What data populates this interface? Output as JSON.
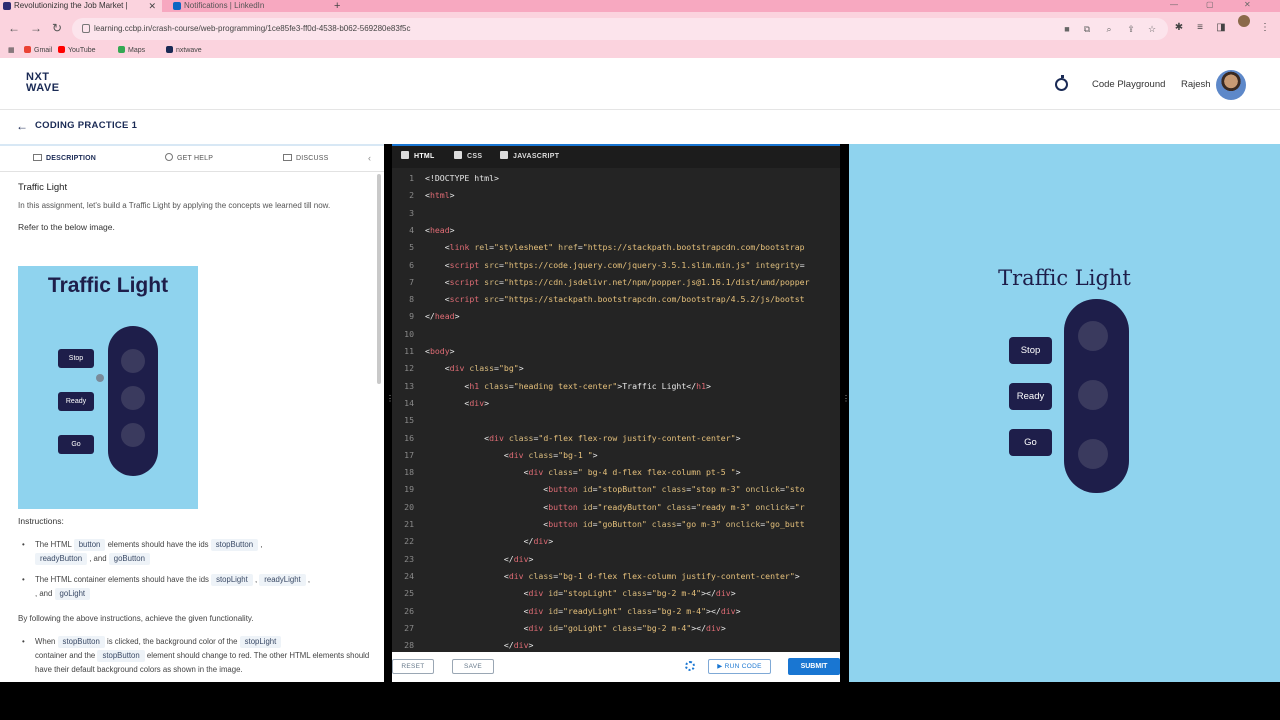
{
  "browser": {
    "tabs": [
      {
        "label": "Revolutionizing the Job Market |",
        "close": "✕"
      },
      {
        "label": "Notifications | LinkedIn"
      }
    ],
    "new_tab": "+",
    "url": "learning.ccbp.in/crash-course/web-programming/1ce85fe3-ff0d-4538-b062-569280e83f5c",
    "bookmarks": [
      {
        "label": "Gmail",
        "color": "#ea4335"
      },
      {
        "label": "YouTube",
        "color": "#ff0000"
      },
      {
        "label": "Maps",
        "color": "#34a853"
      },
      {
        "label": "nxtwave",
        "color": "#1a2a55"
      }
    ]
  },
  "header": {
    "logo_line1": "NXT",
    "logo_line2": "WAVE",
    "playground": "Code Playground",
    "user": "Rajesh"
  },
  "subheader": {
    "back": "←",
    "title": "CODING PRACTICE 1"
  },
  "left": {
    "tabs": [
      "DESCRIPTION",
      "GET HELP",
      "DISCUSS"
    ],
    "collapse": "‹",
    "heading": "Traffic Light",
    "intro": "In this assignment, let's build a Traffic Light by applying the concepts we learned till now.",
    "refer": "Refer to the below image.",
    "preview": {
      "title": "Traffic Light",
      "buttons": [
        "Stop",
        "Ready",
        "Go"
      ]
    },
    "instructions_label": "Instructions:",
    "bullet1": {
      "pre": "The HTML",
      "tag1": "button",
      "mid": "elements should have the ids",
      "tag2": "stopButton",
      "comma": ",",
      "tag3": "readyButton",
      "and": ", and",
      "tag4": "goButton"
    },
    "bullet2": {
      "pre": "The HTML container elements should have the ids",
      "tag1": "stopLight",
      "comma": ",",
      "tag2": "readyLight",
      "and": ", and",
      "tag3": "goLight"
    },
    "following": "By following the above instructions, achieve the given functionality.",
    "bullet3": {
      "pre": "When",
      "tag1": "stopButton",
      "mid": "is clicked, the background color of the",
      "tag2": "stopLight",
      "mid2": "container and the",
      "tag3": "stopButton",
      "end": "element should change to red. The other HTML elements should have their default background colors as shown in the image."
    }
  },
  "editor": {
    "tabs": [
      "HTML",
      "CSS",
      "JAVASCRIPT"
    ],
    "lines": [
      {
        "n": "1",
        "parts": [
          [
            "",
            "<!DOCTYPE html>"
          ]
        ]
      },
      {
        "n": "2",
        "parts": [
          [
            "",
            "<"
          ],
          [
            "t",
            "html"
          ],
          [
            "",
            ">"
          ]
        ]
      },
      {
        "n": "3",
        "parts": []
      },
      {
        "n": "4",
        "parts": [
          [
            "",
            "<"
          ],
          [
            "t",
            "head"
          ],
          [
            "",
            ">"
          ]
        ]
      },
      {
        "n": "5",
        "parts": [
          [
            "",
            "    <"
          ],
          [
            "t",
            "link"
          ],
          [
            "",
            " "
          ],
          [
            "a",
            "rel"
          ],
          [
            "",
            "="
          ],
          [
            "s",
            "\"stylesheet\""
          ],
          [
            "",
            " "
          ],
          [
            "a",
            "href"
          ],
          [
            "",
            "="
          ],
          [
            "s",
            "\"https://stackpath.bootstrapcdn.com/bootstrap"
          ]
        ]
      },
      {
        "n": "6",
        "parts": [
          [
            "",
            "    <"
          ],
          [
            "t",
            "script"
          ],
          [
            "",
            " "
          ],
          [
            "a",
            "src"
          ],
          [
            "",
            "="
          ],
          [
            "s",
            "\"https://code.jquery.com/jquery-3.5.1.slim.min.js\""
          ],
          [
            "",
            " "
          ],
          [
            "a",
            "integrity"
          ],
          [
            "",
            "="
          ]
        ]
      },
      {
        "n": "7",
        "parts": [
          [
            "",
            "    <"
          ],
          [
            "t",
            "script"
          ],
          [
            "",
            " "
          ],
          [
            "a",
            "src"
          ],
          [
            "",
            "="
          ],
          [
            "s",
            "\"https://cdn.jsdelivr.net/npm/popper.js@1.16.1/dist/umd/popper"
          ]
        ]
      },
      {
        "n": "8",
        "parts": [
          [
            "",
            "    <"
          ],
          [
            "t",
            "script"
          ],
          [
            "",
            " "
          ],
          [
            "a",
            "src"
          ],
          [
            "",
            "="
          ],
          [
            "s",
            "\"https://stackpath.bootstrapcdn.com/bootstrap/4.5.2/js/bootst"
          ]
        ]
      },
      {
        "n": "9",
        "parts": [
          [
            "",
            "</"
          ],
          [
            "t",
            "head"
          ],
          [
            "",
            ">"
          ]
        ]
      },
      {
        "n": "10",
        "parts": []
      },
      {
        "n": "11",
        "parts": [
          [
            "",
            "<"
          ],
          [
            "t",
            "body"
          ],
          [
            "",
            ">"
          ]
        ]
      },
      {
        "n": "12",
        "parts": [
          [
            "",
            "    <"
          ],
          [
            "t",
            "div"
          ],
          [
            "",
            " "
          ],
          [
            "a",
            "class"
          ],
          [
            "",
            "="
          ],
          [
            "s",
            "\"bg\""
          ],
          [
            "",
            ">"
          ]
        ]
      },
      {
        "n": "13",
        "parts": [
          [
            "",
            "        <"
          ],
          [
            "t",
            "h1"
          ],
          [
            "",
            " "
          ],
          [
            "a",
            "class"
          ],
          [
            "",
            "="
          ],
          [
            "s",
            "\"heading text-center\""
          ],
          [
            "",
            ">Traffic Light</"
          ],
          [
            "t",
            "h1"
          ],
          [
            "",
            ">"
          ]
        ]
      },
      {
        "n": "14",
        "parts": [
          [
            "",
            "        <"
          ],
          [
            "t",
            "div"
          ],
          [
            "",
            ">"
          ]
        ]
      },
      {
        "n": "15",
        "parts": []
      },
      {
        "n": "16",
        "parts": [
          [
            "",
            "            <"
          ],
          [
            "t",
            "div"
          ],
          [
            "",
            " "
          ],
          [
            "a",
            "class"
          ],
          [
            "",
            "="
          ],
          [
            "s",
            "\"d-flex flex-row justify-content-center\""
          ],
          [
            "",
            ">"
          ]
        ]
      },
      {
        "n": "17",
        "parts": [
          [
            "",
            "                <"
          ],
          [
            "t",
            "div"
          ],
          [
            "",
            " "
          ],
          [
            "a",
            "class"
          ],
          [
            "",
            "="
          ],
          [
            "s",
            "\"bg-1 \""
          ],
          [
            "",
            ">"
          ]
        ]
      },
      {
        "n": "18",
        "parts": [
          [
            "",
            "                    <"
          ],
          [
            "t",
            "div"
          ],
          [
            "",
            " "
          ],
          [
            "a",
            "class"
          ],
          [
            "",
            "="
          ],
          [
            "s",
            "\" bg-4 d-flex flex-column pt-5 \""
          ],
          [
            "",
            ">"
          ]
        ]
      },
      {
        "n": "19",
        "parts": [
          [
            "",
            "                        <"
          ],
          [
            "t",
            "button"
          ],
          [
            "",
            " "
          ],
          [
            "a",
            "id"
          ],
          [
            "",
            "="
          ],
          [
            "s",
            "\"stopButton\""
          ],
          [
            "",
            " "
          ],
          [
            "a",
            "class"
          ],
          [
            "",
            "="
          ],
          [
            "s",
            "\"stop m-3\""
          ],
          [
            "",
            " "
          ],
          [
            "a",
            "onclick"
          ],
          [
            "",
            "="
          ],
          [
            "s",
            "\"sto"
          ]
        ]
      },
      {
        "n": "20",
        "parts": [
          [
            "",
            "                        <"
          ],
          [
            "t",
            "button"
          ],
          [
            "",
            " "
          ],
          [
            "a",
            "id"
          ],
          [
            "",
            "="
          ],
          [
            "s",
            "\"readyButton\""
          ],
          [
            "",
            " "
          ],
          [
            "a",
            "class"
          ],
          [
            "",
            "="
          ],
          [
            "s",
            "\"ready m-3\""
          ],
          [
            "",
            " "
          ],
          [
            "a",
            "onclick"
          ],
          [
            "",
            "="
          ],
          [
            "s",
            "\"r"
          ]
        ]
      },
      {
        "n": "21",
        "parts": [
          [
            "",
            "                        <"
          ],
          [
            "t",
            "button"
          ],
          [
            "",
            " "
          ],
          [
            "a",
            "id"
          ],
          [
            "",
            "="
          ],
          [
            "s",
            "\"goButton\""
          ],
          [
            "",
            " "
          ],
          [
            "a",
            "class"
          ],
          [
            "",
            "="
          ],
          [
            "s",
            "\"go m-3\""
          ],
          [
            "",
            " "
          ],
          [
            "a",
            "onclick"
          ],
          [
            "",
            "="
          ],
          [
            "s",
            "\"go_butt"
          ]
        ]
      },
      {
        "n": "22",
        "parts": [
          [
            "",
            "                    </"
          ],
          [
            "t",
            "div"
          ],
          [
            "",
            ">"
          ]
        ]
      },
      {
        "n": "23",
        "parts": [
          [
            "",
            "                </"
          ],
          [
            "t",
            "div"
          ],
          [
            "",
            ">"
          ]
        ]
      },
      {
        "n": "24",
        "parts": [
          [
            "",
            "                <"
          ],
          [
            "t",
            "div"
          ],
          [
            "",
            " "
          ],
          [
            "a",
            "class"
          ],
          [
            "",
            "="
          ],
          [
            "s",
            "\"bg-1 d-flex flex-column justify-content-center\""
          ],
          [
            "",
            ">"
          ]
        ]
      },
      {
        "n": "25",
        "parts": [
          [
            "",
            "                    <"
          ],
          [
            "t",
            "div"
          ],
          [
            "",
            " "
          ],
          [
            "a",
            "id"
          ],
          [
            "",
            "="
          ],
          [
            "s",
            "\"stopLight\""
          ],
          [
            "",
            " "
          ],
          [
            "a",
            "class"
          ],
          [
            "",
            "="
          ],
          [
            "s",
            "\"bg-2 m-4\""
          ],
          [
            "",
            "></"
          ],
          [
            "t",
            "div"
          ],
          [
            "",
            ">"
          ]
        ]
      },
      {
        "n": "26",
        "parts": [
          [
            "",
            "                    <"
          ],
          [
            "t",
            "div"
          ],
          [
            "",
            " "
          ],
          [
            "a",
            "id"
          ],
          [
            "",
            "="
          ],
          [
            "s",
            "\"readyLight\""
          ],
          [
            "",
            " "
          ],
          [
            "a",
            "class"
          ],
          [
            "",
            "="
          ],
          [
            "s",
            "\"bg-2 m-4\""
          ],
          [
            "",
            "></"
          ],
          [
            "t",
            "div"
          ],
          [
            "",
            ">"
          ]
        ]
      },
      {
        "n": "27",
        "parts": [
          [
            "",
            "                    <"
          ],
          [
            "t",
            "div"
          ],
          [
            "",
            " "
          ],
          [
            "a",
            "id"
          ],
          [
            "",
            "="
          ],
          [
            "s",
            "\"goLight\""
          ],
          [
            "",
            " "
          ],
          [
            "a",
            "class"
          ],
          [
            "",
            "="
          ],
          [
            "s",
            "\"bg-2 m-4\""
          ],
          [
            "",
            "></"
          ],
          [
            "t",
            "div"
          ],
          [
            "",
            ">"
          ]
        ]
      },
      {
        "n": "28",
        "parts": [
          [
            "",
            "                </"
          ],
          [
            "t",
            "div"
          ],
          [
            "",
            ">"
          ]
        ]
      }
    ],
    "actions": {
      "reset": "RESET",
      "save": "SAVE",
      "run": "▶ RUN CODE",
      "submit": "SUBMIT"
    }
  },
  "output": {
    "title": "Traffic Light",
    "buttons": [
      "Stop",
      "Ready",
      "Go"
    ]
  }
}
